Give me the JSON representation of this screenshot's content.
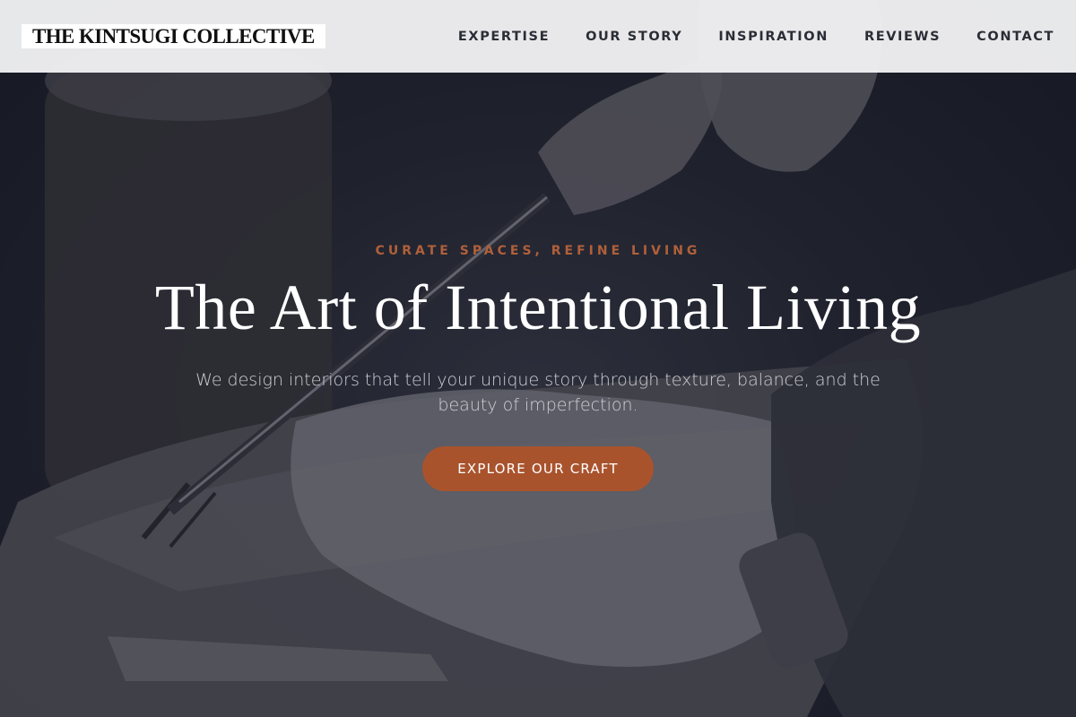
{
  "site": {
    "logo_text": "THE KINTSUGI COLLECTIVE"
  },
  "nav": {
    "items": [
      {
        "label": "EXPERTISE"
      },
      {
        "label": "OUR STORY"
      },
      {
        "label": "INSPIRATION"
      },
      {
        "label": "REVIEWS"
      },
      {
        "label": "CONTACT"
      }
    ]
  },
  "hero": {
    "eyebrow": "CURATE SPACES, REFINE LIVING",
    "headline": "The Art of Intentional Living",
    "subhead": "We design interiors that tell your unique story through texture, balance, and the beauty of imperfection.",
    "cta_label": "EXPLORE OUR CRAFT",
    "background_image": "woodcarving-hands-photo"
  },
  "colors": {
    "accent": "#a9532d",
    "eyebrow": "#b0603a",
    "header_bg": "#f0f0f2",
    "hero_bg": "#1c1e29"
  }
}
